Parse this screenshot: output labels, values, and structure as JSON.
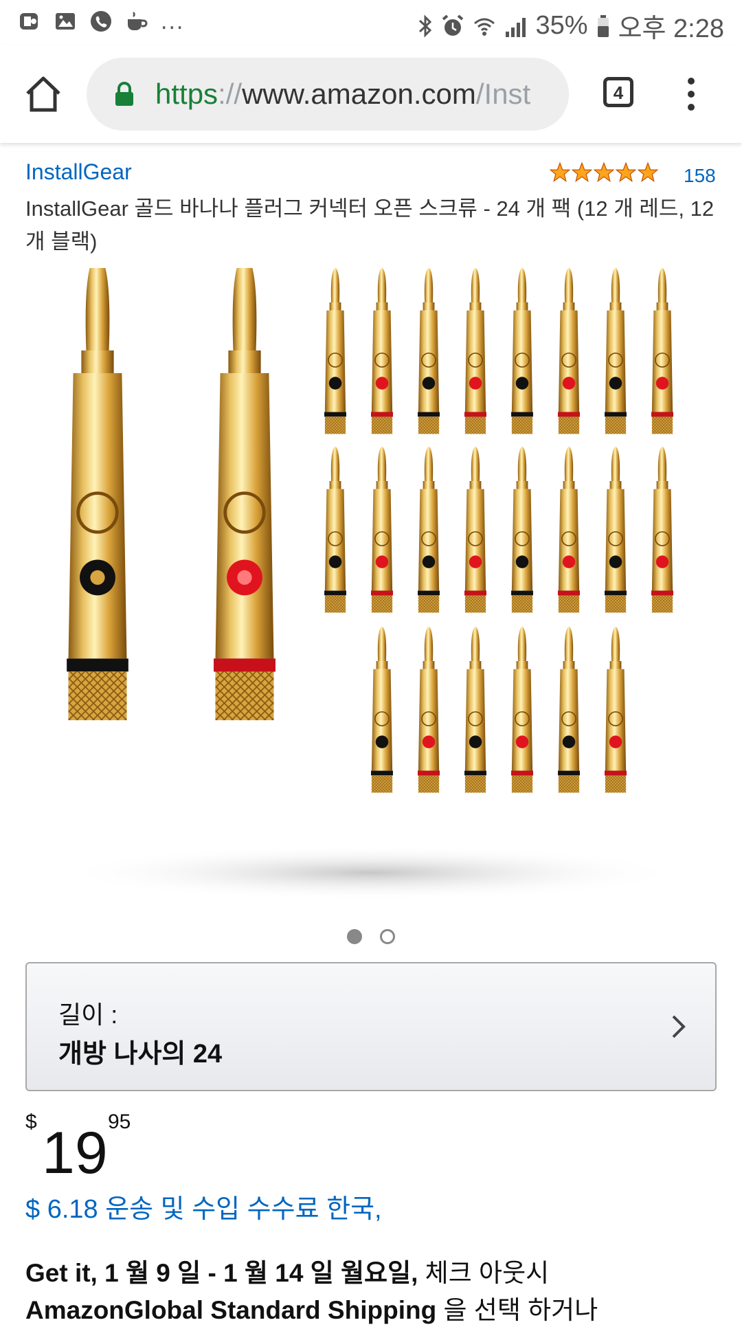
{
  "status_bar": {
    "overflow": "...",
    "battery": "35%",
    "time": "오후 2:28",
    "left_icons": [
      "app-notification-icon",
      "image-icon",
      "phone-icon",
      "coffee-icon"
    ],
    "right_icons": [
      "bluetooth-icon",
      "alarm-icon",
      "wifi-icon",
      "signal-icon",
      "battery-icon"
    ]
  },
  "browser": {
    "url_scheme": "https",
    "url_sep": "://",
    "url_host": "www.amazon.com",
    "url_path": "/Inst",
    "tab_count": "4",
    "secure_color": "#188038"
  },
  "product": {
    "brand": "InstallGear",
    "rating": 5,
    "review_count": "158",
    "title": "InstallGear 골드 바나나 플러그 커넥터 오픈 스크류 - 24 개 팩 (12 개 레드, 12 개 블랙)",
    "image_alt": "gold banana plug connectors",
    "carousel_total": 2,
    "carousel_active": 1
  },
  "variation": {
    "label": "길이 :",
    "value": "개방 나사의 24"
  },
  "price": {
    "symbol": "$",
    "whole": "19",
    "fraction": "95",
    "shipping": "$ 6.18 운송 및 수입 수수료 한국,"
  },
  "delivery": {
    "part1": "Get it, 1 월 9 일 - 1 월 14 일 월요일,",
    "part2": " 체크 아웃시",
    "part3": "AmazonGlobal Standard Shipping",
    "part4": " 을 선택 하거나"
  },
  "colors": {
    "link": "#0066c0",
    "star": "#ffa41c",
    "gold": "#d4a017"
  }
}
